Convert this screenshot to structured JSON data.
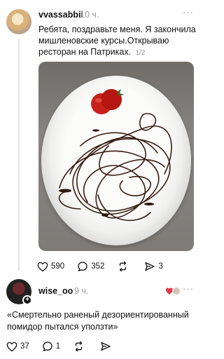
{
  "post1": {
    "username": "vvassabbii",
    "time": "10 ч.",
    "more_label": "···",
    "text": "Ребята, поздравьте меня. Я закончила мишленовские курсы.Открываю ресторан на Патриках.",
    "image_counter": "1/2",
    "likes": "590",
    "comments": "352",
    "shares": "3"
  },
  "post2": {
    "username": "wise_oo",
    "time": "9 ч.",
    "more_label": "···",
    "text": "«Смертельно раненый дезориентированный помидор пытался уползти»",
    "likes": "37",
    "comments": "1"
  },
  "colors": {
    "text": "#111111",
    "muted": "#9a9a9a",
    "thread_line": "#e2e2e2",
    "heart_badge": "#e23b4a"
  },
  "icons": [
    "heart-icon",
    "comment-icon",
    "repost-icon",
    "share-icon",
    "more-icon",
    "plus-icon"
  ]
}
